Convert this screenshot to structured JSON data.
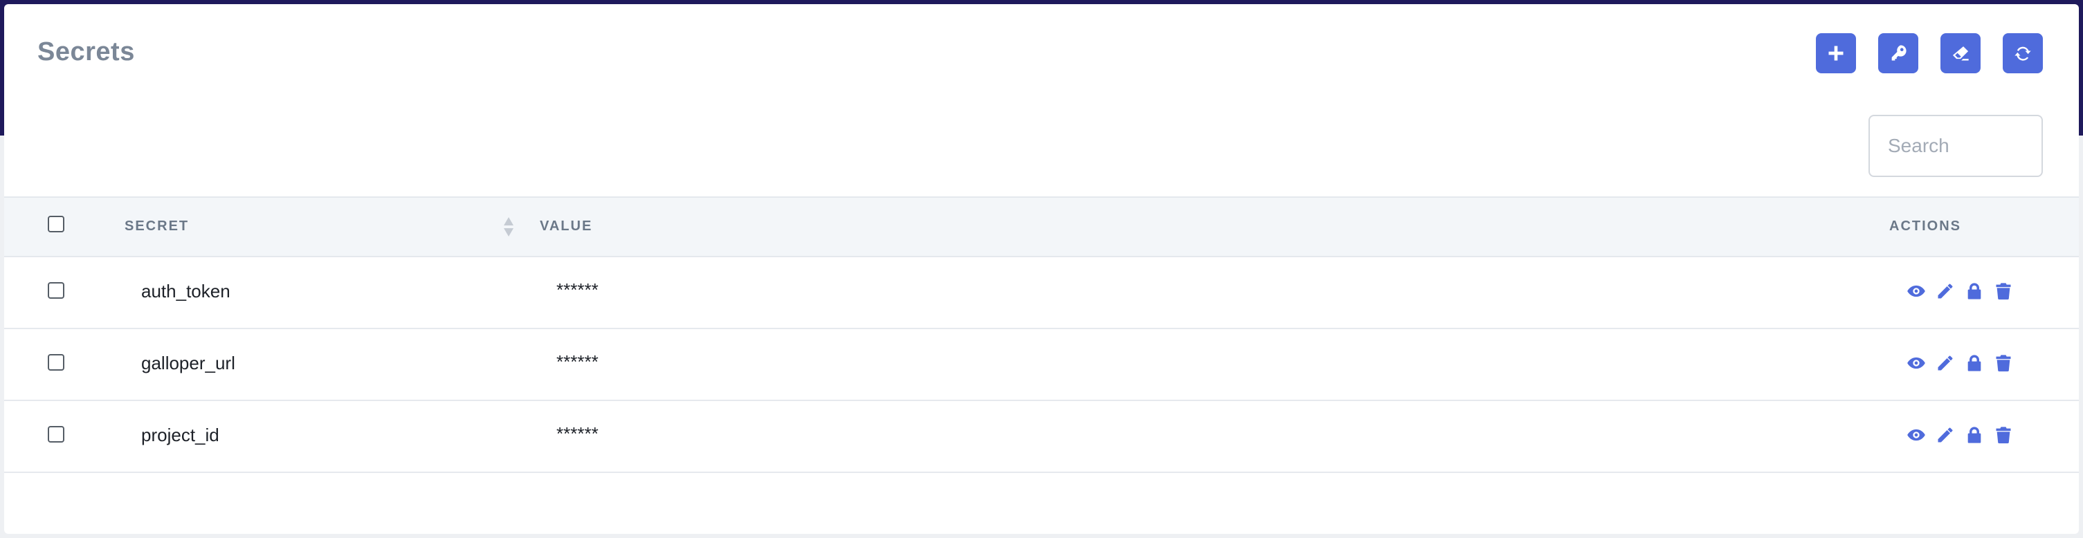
{
  "page": {
    "title": "Secrets"
  },
  "toolbar": {
    "buttons": [
      {
        "name": "add-secret-button",
        "icon": "plus-icon"
      },
      {
        "name": "key-button",
        "icon": "key-icon"
      },
      {
        "name": "clear-button",
        "icon": "eraser-icon"
      },
      {
        "name": "refresh-button",
        "icon": "refresh-icon"
      }
    ]
  },
  "search": {
    "placeholder": "Search",
    "value": ""
  },
  "table": {
    "columns": {
      "secret": "SECRET",
      "value": "VALUE",
      "actions": "ACTIONS"
    },
    "rows": [
      {
        "secret": "auth_token",
        "value": "******"
      },
      {
        "secret": "galloper_url",
        "value": "******"
      },
      {
        "secret": "project_id",
        "value": "******"
      }
    ],
    "row_actions": [
      "eye-icon",
      "pencil-icon",
      "lock-icon",
      "trash-icon"
    ]
  },
  "colors": {
    "accent": "#4f6bdc",
    "title": "#7b8797",
    "header_bg": "#f3f6f9",
    "frame": "#1f1a5c"
  }
}
